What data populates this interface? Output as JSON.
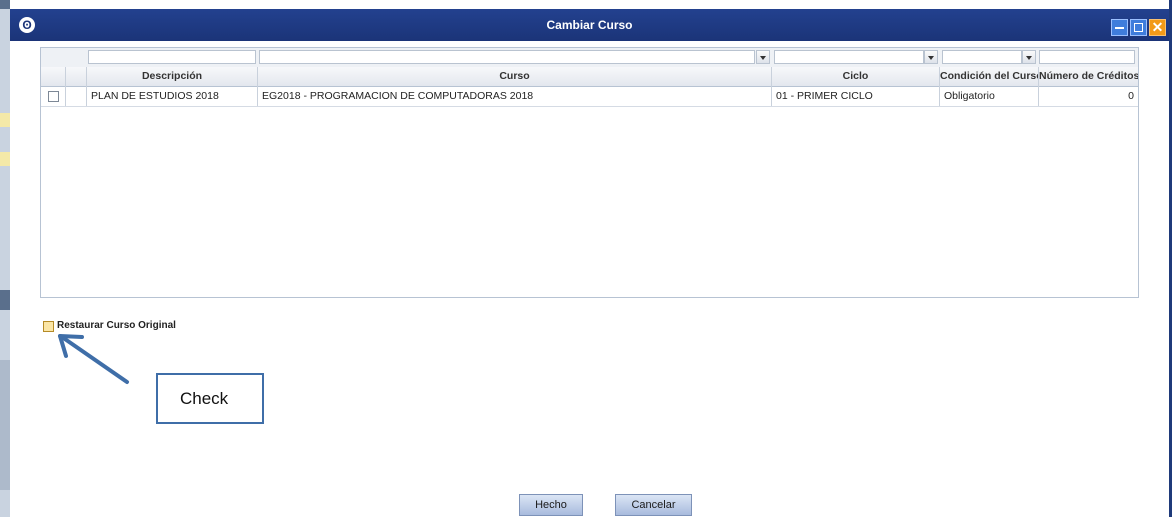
{
  "dialog": {
    "title": "Cambiar Curso"
  },
  "grid": {
    "columns": [
      "Descripción",
      "Curso",
      "Ciclo",
      "Condición del Curso",
      "Número de Créditos"
    ],
    "rows": [
      {
        "descripcion": "PLAN DE ESTUDIOS 2018",
        "curso": "EG2018 - PROGRAMACION DE COMPUTADORAS 2018",
        "ciclo": "01 - PRIMER CICLO",
        "condicion": "Obligatorio",
        "creditos": "0",
        "checked": false
      }
    ]
  },
  "restore": {
    "label": "Restaurar Curso Original",
    "checked": false
  },
  "annotation": {
    "text": "Check"
  },
  "buttons": {
    "done": "Hecho",
    "cancel": "Cancelar"
  },
  "colors": {
    "titlebar": "#1b3478",
    "annotation": "#3f6ea8",
    "close_button": "#f29a18"
  }
}
